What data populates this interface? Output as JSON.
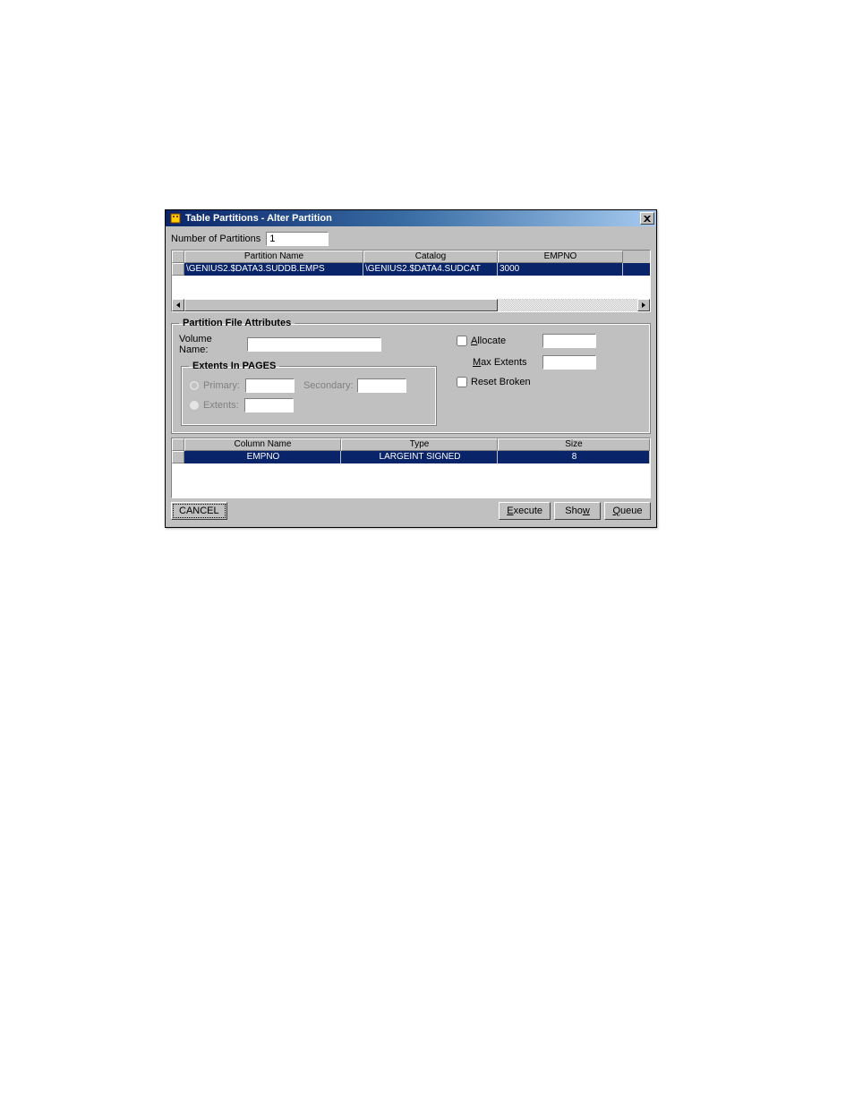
{
  "title": "Table Partitions - Alter Partition",
  "num_partitions": {
    "label": "Number of Partitions",
    "value": "1"
  },
  "partitions_table": {
    "headers": [
      "Partition Name",
      "Catalog",
      "EMPNO"
    ],
    "rows": [
      {
        "name": "\\GENIUS2.$DATA3.SUDDB.EMPS",
        "catalog": "\\GENIUS2.$DATA4.SUDCAT",
        "empno": "3000"
      }
    ]
  },
  "attributes": {
    "legend": "Partition File Attributes",
    "volume_name": {
      "label": "Volume Name:",
      "value": ""
    },
    "extents": {
      "legend": "Extents In PAGES",
      "primary": {
        "label": "Primary:",
        "value": ""
      },
      "secondary": {
        "label": "Secondary:",
        "value": ""
      },
      "extents": {
        "label": "Extents:",
        "value": ""
      }
    },
    "allocate": {
      "label": "Allocate",
      "value": ""
    },
    "max_extents": {
      "label": "Max Extents",
      "value": ""
    },
    "reset_broken": {
      "label": "Reset Broken"
    }
  },
  "columns_table": {
    "headers": [
      "Column Name",
      "Type",
      "Size"
    ],
    "rows": [
      {
        "name": "EMPNO",
        "type": "LARGEINT SIGNED",
        "size": "8"
      }
    ]
  },
  "buttons": {
    "cancel": "CANCEL",
    "execute": "Execute",
    "show": "Show",
    "queue": "Queue"
  }
}
